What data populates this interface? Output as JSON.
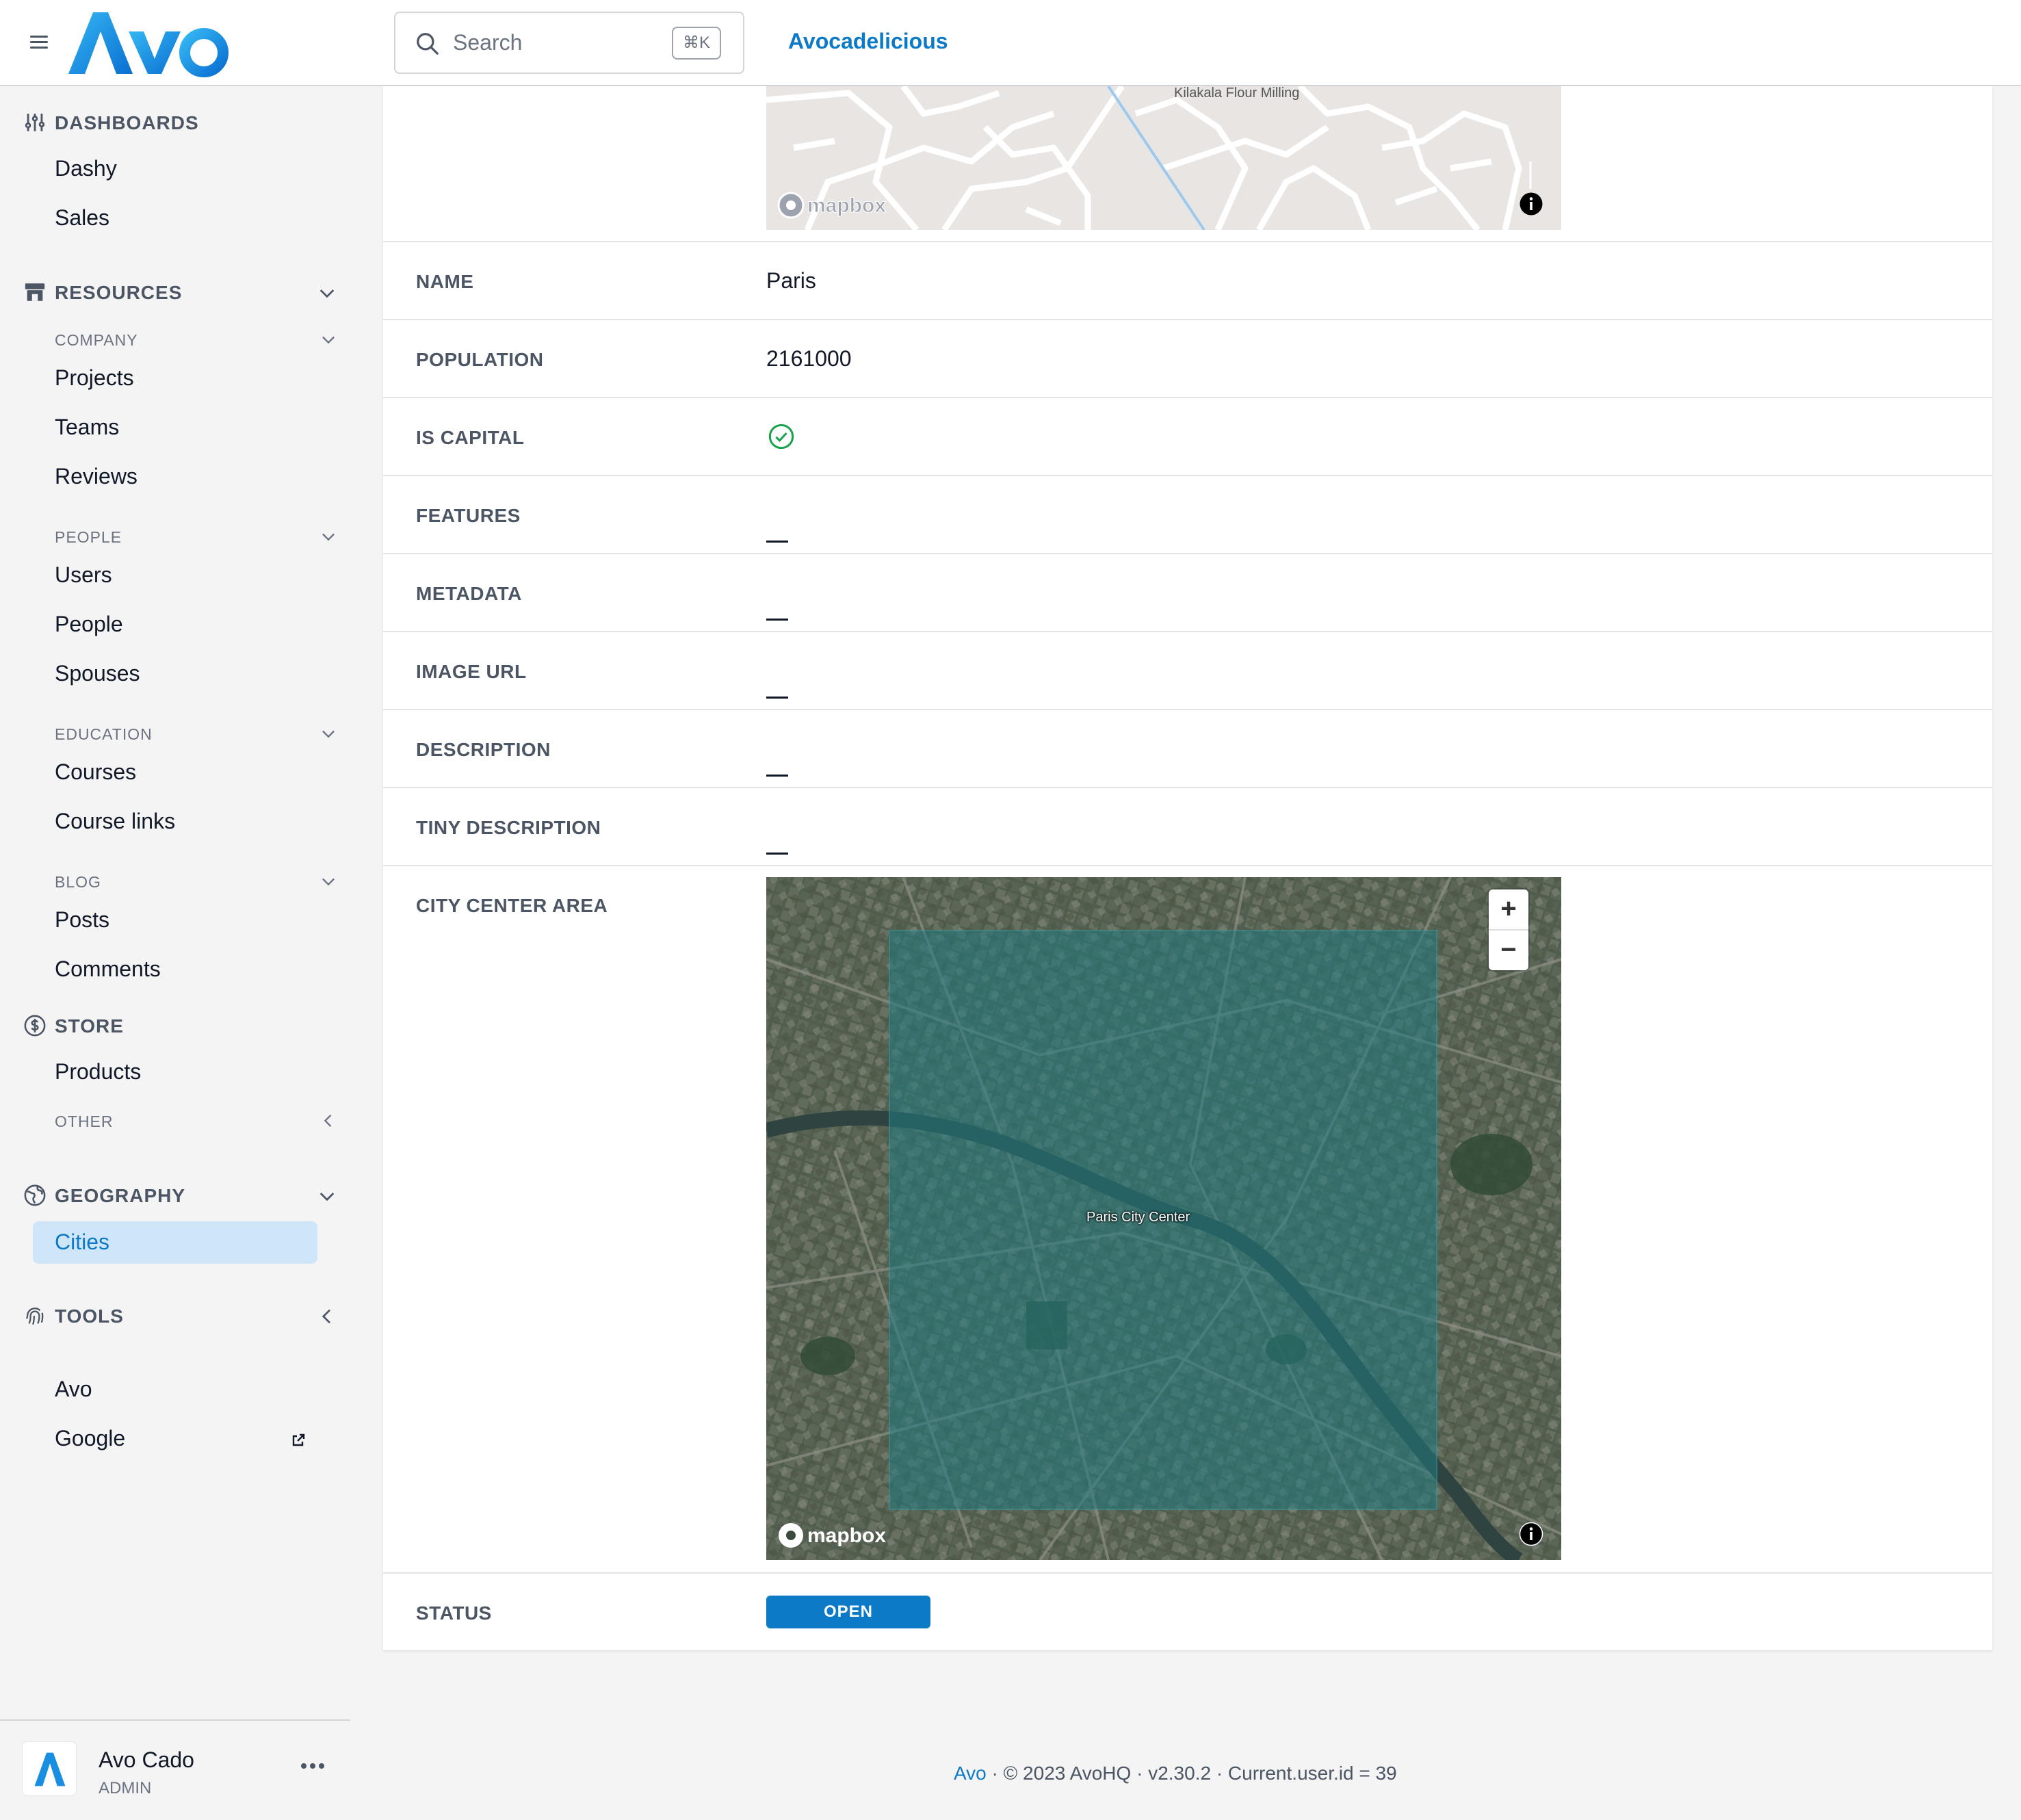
{
  "header": {
    "logo_text": "Avo",
    "search_placeholder": "Search",
    "search_shortcut": "⌘K",
    "app_link": "Avocadelicious"
  },
  "sidebar": {
    "dashboards": {
      "label": "DASHBOARDS",
      "items": [
        "Dashy",
        "Sales"
      ]
    },
    "resources": {
      "label": "RESOURCES",
      "groups": [
        {
          "label": "COMPANY",
          "items": [
            "Projects",
            "Teams",
            "Reviews"
          ]
        },
        {
          "label": "PEOPLE",
          "items": [
            "Users",
            "People",
            "Spouses"
          ]
        },
        {
          "label": "EDUCATION",
          "items": [
            "Courses",
            "Course links"
          ]
        },
        {
          "label": "BLOG",
          "items": [
            "Posts",
            "Comments"
          ]
        }
      ]
    },
    "store": {
      "label": "STORE",
      "items": [
        "Products"
      ],
      "other_label": "OTHER"
    },
    "geography": {
      "label": "GEOGRAPHY",
      "active_item": "Cities"
    },
    "tools": {
      "label": "TOOLS",
      "items": [
        "Avo",
        "Google"
      ]
    }
  },
  "user": {
    "name": "Avo Cado",
    "role": "ADMIN"
  },
  "record": {
    "top_map": {
      "place_label": "Kilakala Flour Milling",
      "attribution": "mapbox"
    },
    "fields": [
      {
        "key": "NAME",
        "value": "Paris"
      },
      {
        "key": "POPULATION",
        "value": "2161000"
      },
      {
        "key": "IS CAPITAL",
        "value": true
      },
      {
        "key": "FEATURES",
        "value": "—"
      },
      {
        "key": "METADATA",
        "value": "—"
      },
      {
        "key": "IMAGE URL",
        "value": "—"
      },
      {
        "key": "DESCRIPTION",
        "value": "—"
      },
      {
        "key": "TINY DESCRIPTION",
        "value": "—"
      },
      {
        "key": "CITY CENTER AREA",
        "value": "map"
      },
      {
        "key": "STATUS",
        "value": "OPEN"
      }
    ],
    "area_map": {
      "area_label": "Paris City Center",
      "attribution": "mapbox",
      "zoom_in": "+",
      "zoom_out": "−"
    }
  },
  "footer": {
    "link": "Avo",
    "text": " · © 2023 AvoHQ · v2.30.2 · Current.user.id = 39"
  },
  "colors": {
    "accent": "#0d7ac8",
    "active_bg": "#cfe6f9",
    "success": "#16a34a"
  }
}
